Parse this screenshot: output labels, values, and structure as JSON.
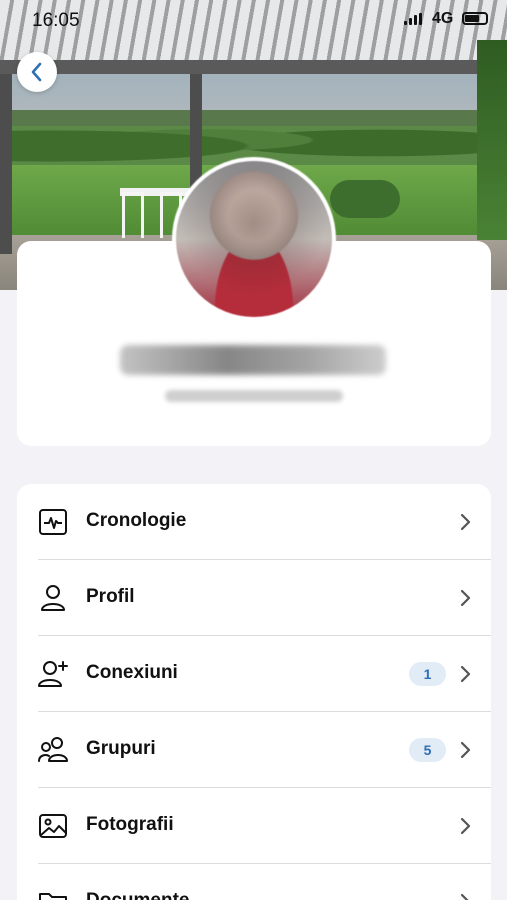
{
  "status_bar": {
    "time": "16:05",
    "network": "4G"
  },
  "header": {
    "back_icon": "chevron-left-icon",
    "accent_color": "#2f6fb3"
  },
  "profile": {
    "name": "",
    "subtitle": ""
  },
  "menu": {
    "items": [
      {
        "label": "Cronologie",
        "icon": "activity-icon",
        "badge": null
      },
      {
        "label": "Profil",
        "icon": "person-icon",
        "badge": null
      },
      {
        "label": "Conexiuni",
        "icon": "person-add-icon",
        "badge": "1"
      },
      {
        "label": "Grupuri",
        "icon": "people-icon",
        "badge": "5"
      },
      {
        "label": "Fotografii",
        "icon": "photo-icon",
        "badge": null
      },
      {
        "label": "Documente",
        "icon": "folder-icon",
        "badge": null
      }
    ]
  }
}
